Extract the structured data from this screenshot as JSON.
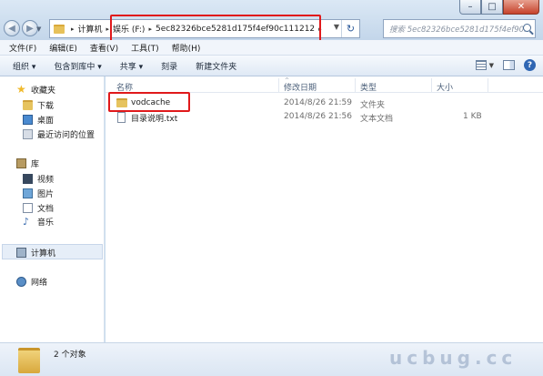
{
  "window": {
    "minimize_glyph": "–",
    "maximize_glyph": "□",
    "close_glyph": "✕"
  },
  "address_bar": {
    "crumbs": [
      "计算机",
      "娱乐 (F:)",
      "5ec82326bce5281d175f4ef90c111212"
    ],
    "separator": "▸"
  },
  "search": {
    "placeholder": "搜索 5ec82326bce5281d175f4ef90..."
  },
  "menu": [
    "文件(F)",
    "编辑(E)",
    "查看(V)",
    "工具(T)",
    "帮助(H)"
  ],
  "toolbar": {
    "organize": "组织 ▾",
    "include_in_library": "包含到库中 ▾",
    "share": "共享 ▾",
    "burn": "刻录",
    "new_folder": "新建文件夹"
  },
  "sidebar": {
    "favorites": "收藏夹",
    "downloads": "下载",
    "desktop": "桌面",
    "recent": "最近访问的位置",
    "libraries": "库",
    "videos": "视频",
    "pictures": "图片",
    "documents": "文档",
    "music": "音乐",
    "computer": "计算机",
    "network": "网络"
  },
  "columns": {
    "name": "名称",
    "modified": "修改日期",
    "type": "类型",
    "size": "大小",
    "sort_arrow": "^"
  },
  "files": [
    {
      "name": "vodcache",
      "modified": "2014/8/26 21:59",
      "type": "文件夹",
      "size": ""
    },
    {
      "name": "目录说明.txt",
      "modified": "2014/8/26 21:56",
      "type": "文本文档",
      "size": "1 KB"
    }
  ],
  "status": {
    "count": "2 个对象"
  },
  "watermark": "ucbug.cc",
  "colors": {
    "highlight_box": "#e0191b",
    "window_frame": "#c9dcee"
  }
}
